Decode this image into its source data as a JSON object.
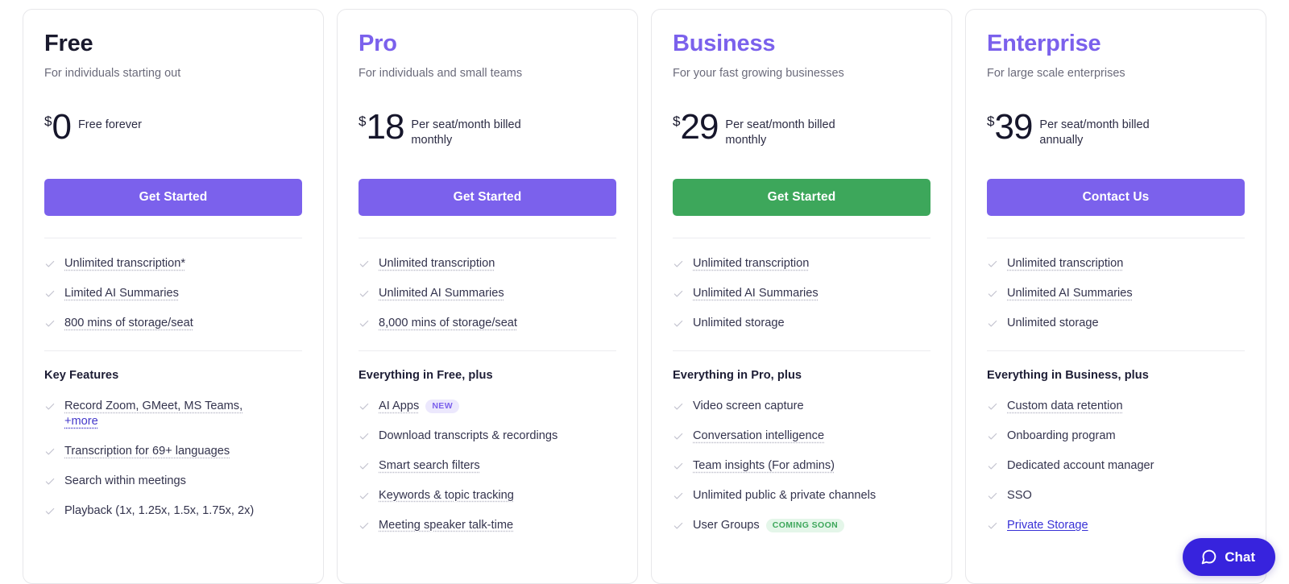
{
  "colors": {
    "accent_purple": "#7B61EC",
    "accent_green": "#3DA75B",
    "chat_blue": "#3723DD",
    "link_blue": "#3730D6",
    "heading_dark": "#1A1A2E",
    "muted_text": "#6B6B7B",
    "card_border": "#E7E7EA",
    "divider": "#ECECF0",
    "check_gray": "#C3C3CF",
    "badge_new_bg": "#ECE8FD",
    "badge_soon_bg": "#E4F6E9"
  },
  "chat": {
    "label": "Chat",
    "icon": "chat-bubble-icon"
  },
  "plans": [
    {
      "name": "Free",
      "name_accent": false,
      "tagline": "For individuals starting out",
      "currency": "$",
      "amount": "0",
      "price_note": "Free forever",
      "cta_label": "Get Started",
      "cta_style": "purple",
      "top_features": [
        {
          "text": "Unlimited transcription*",
          "style": "tooltip"
        },
        {
          "text": "Limited AI Summaries",
          "style": "tooltip"
        },
        {
          "text": "800 mins of storage/seat",
          "style": "tooltip"
        }
      ],
      "section_title": "Key Features",
      "features": [
        {
          "text": "Record Zoom, GMeet, MS Teams,",
          "style": "tooltip",
          "link_suffix": "+more"
        },
        {
          "text": "Transcription for 69+ languages",
          "style": "tooltip"
        },
        {
          "text": "Search within meetings",
          "style": "plain"
        },
        {
          "text": "Playback (1x, 1.25x, 1.5x, 1.75x, 2x)",
          "style": "plain"
        }
      ]
    },
    {
      "name": "Pro",
      "name_accent": true,
      "tagline": "For individuals and small teams",
      "currency": "$",
      "amount": "18",
      "price_note": "Per seat/month billed monthly",
      "cta_label": "Get Started",
      "cta_style": "purple",
      "top_features": [
        {
          "text": "Unlimited transcription",
          "style": "tooltip"
        },
        {
          "text": "Unlimited AI Summaries",
          "style": "tooltip"
        },
        {
          "text": "8,000 mins of storage/seat",
          "style": "tooltip"
        }
      ],
      "section_title": "Everything in Free, plus",
      "features": [
        {
          "text": "AI Apps",
          "style": "tooltip",
          "badge": {
            "label": "NEW",
            "type": "new"
          }
        },
        {
          "text": "Download transcripts & recordings",
          "style": "plain"
        },
        {
          "text": "Smart search filters",
          "style": "tooltip"
        },
        {
          "text": "Keywords & topic tracking",
          "style": "tooltip"
        },
        {
          "text": "Meeting speaker talk-time",
          "style": "tooltip"
        }
      ]
    },
    {
      "name": "Business",
      "name_accent": true,
      "tagline": "For your fast growing businesses",
      "currency": "$",
      "amount": "29",
      "price_note": "Per seat/month billed monthly",
      "cta_label": "Get Started",
      "cta_style": "green",
      "top_features": [
        {
          "text": "Unlimited transcription",
          "style": "tooltip"
        },
        {
          "text": "Unlimited AI Summaries",
          "style": "tooltip"
        },
        {
          "text": "Unlimited storage",
          "style": "plain"
        }
      ],
      "section_title": "Everything in Pro, plus",
      "features": [
        {
          "text": "Video screen capture",
          "style": "plain"
        },
        {
          "text": "Conversation intelligence",
          "style": "tooltip"
        },
        {
          "text": "Team insights (For admins)",
          "style": "tooltip"
        },
        {
          "text": "Unlimited public & private channels",
          "style": "plain"
        },
        {
          "text": "User Groups",
          "style": "plain",
          "badge": {
            "label": "COMING SOON",
            "type": "soon"
          }
        }
      ]
    },
    {
      "name": "Enterprise",
      "name_accent": true,
      "tagline": "For large scale enterprises",
      "currency": "$",
      "amount": "39",
      "price_note": "Per seat/month billed annually",
      "cta_label": "Contact Us",
      "cta_style": "purple",
      "top_features": [
        {
          "text": "Unlimited transcription",
          "style": "tooltip"
        },
        {
          "text": "Unlimited AI Summaries",
          "style": "tooltip"
        },
        {
          "text": "Unlimited storage",
          "style": "plain"
        }
      ],
      "section_title": "Everything in Business, plus",
      "features": [
        {
          "text": "Custom data retention",
          "style": "tooltip"
        },
        {
          "text": "Onboarding program",
          "style": "plain"
        },
        {
          "text": "Dedicated account manager",
          "style": "plain"
        },
        {
          "text": "SSO",
          "style": "plain"
        },
        {
          "text": "Private Storage",
          "style": "link"
        }
      ]
    }
  ]
}
